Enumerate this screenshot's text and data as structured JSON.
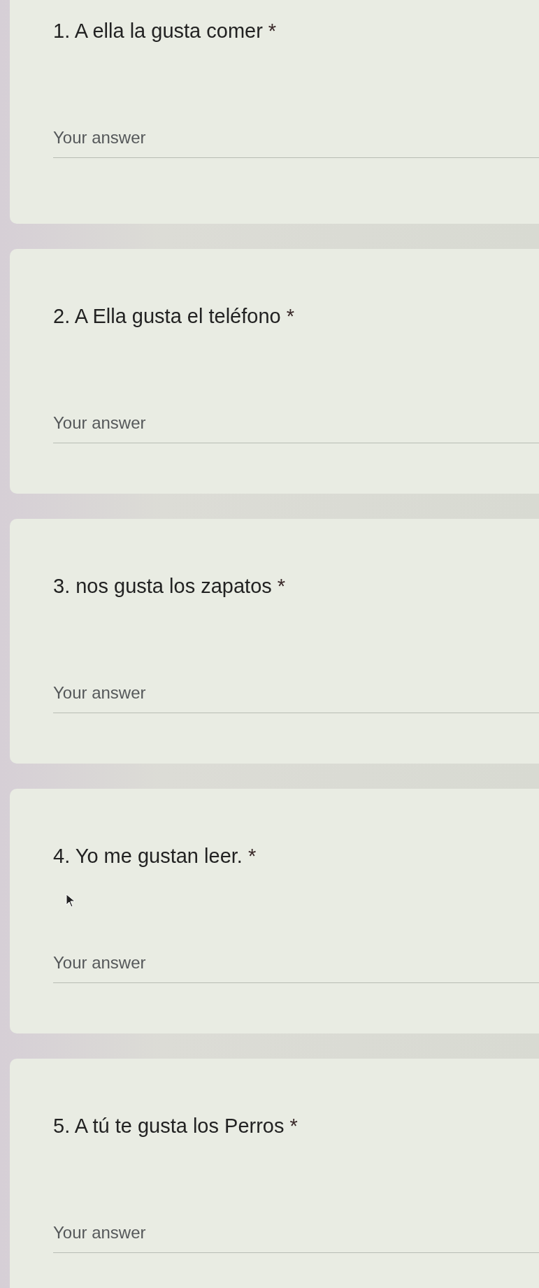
{
  "questions": [
    {
      "title": "1. A ella la gusta comer",
      "required_mark": "*",
      "answer": {
        "placeholder": "Your answer"
      }
    },
    {
      "title": "2. A Ella gusta el teléfono",
      "required_mark": "*",
      "answer": {
        "placeholder": "Your answer"
      }
    },
    {
      "title": "3. nos gusta los zapatos",
      "required_mark": "*",
      "answer": {
        "placeholder": "Your answer"
      }
    },
    {
      "title": "4. Yo me gustan leer.",
      "required_mark": "*",
      "answer": {
        "placeholder": "Your answer"
      },
      "pointer": true
    },
    {
      "title": "5. A tú te gusta los Perros",
      "required_mark": "*",
      "answer": {
        "placeholder": "Your answer"
      }
    }
  ]
}
